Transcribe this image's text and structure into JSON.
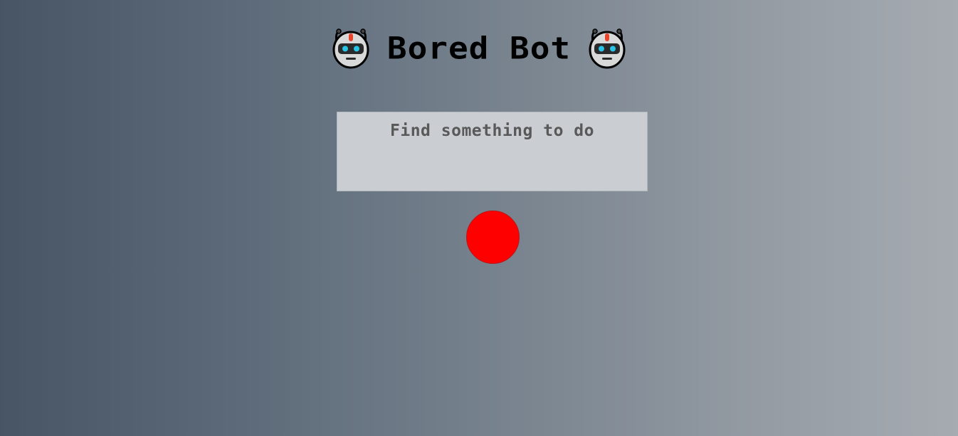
{
  "header": {
    "title": "Bored Bot",
    "left_icon": "robot-face-icon",
    "right_icon": "robot-face-icon"
  },
  "prompt": {
    "text": "Find something to do"
  },
  "action_button": {
    "icon": "red-circle-button",
    "color": "#ff0000"
  },
  "colors": {
    "background_start": "#475565",
    "background_end": "#a6abb1",
    "box_background": "#caced2",
    "prompt_text": "#595959",
    "accent": "#ff0000"
  }
}
